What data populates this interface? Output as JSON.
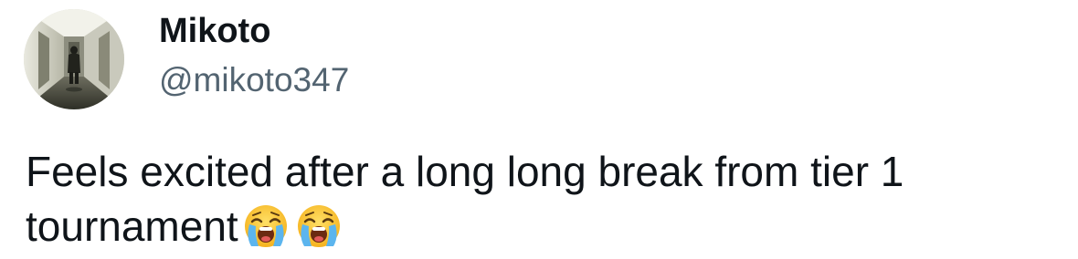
{
  "user": {
    "display_name": "Mikoto",
    "handle": "@mikoto347",
    "avatar_icon": "hallway-photo-avatar"
  },
  "tweet": {
    "text_line1": "Feels excited after a long long break from tier 1",
    "text_line2": "tournament",
    "emojis": [
      "loudly-crying-face-emoji",
      "loudly-crying-face-emoji"
    ]
  },
  "colors": {
    "text": "#0f1419",
    "secondary_text": "#536471",
    "background": "#ffffff"
  }
}
